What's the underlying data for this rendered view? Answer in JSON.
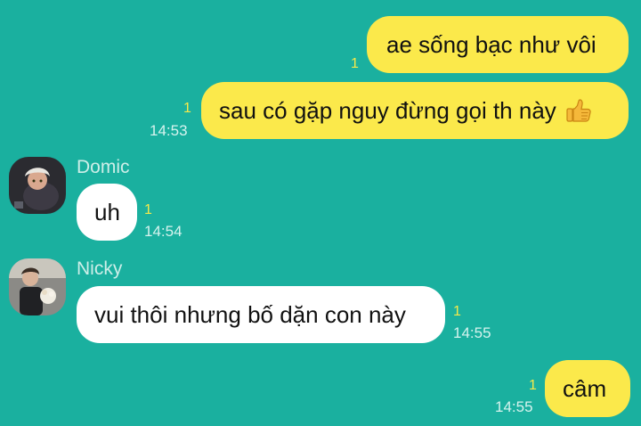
{
  "colors": {
    "background": "#1ab09f",
    "outgoing_bubble": "#fbe94b",
    "incoming_bubble": "#ffffff",
    "unread_count": "#f6e94a",
    "timestamp": "#d6f3ee"
  },
  "messages": [
    {
      "direction": "outgoing",
      "text": "ae sống bạc như vôi",
      "unread": "1",
      "time": ""
    },
    {
      "direction": "outgoing",
      "text": "sau có gặp nguy đừng gọi th này",
      "emoji": "thumbs-up-icon",
      "unread": "1",
      "time": "14:53"
    },
    {
      "direction": "incoming",
      "sender": "Domic",
      "text": "uh",
      "unread": "1",
      "time": "14:54"
    },
    {
      "direction": "incoming",
      "sender": "Nicky",
      "text": "vui thôi nhưng bố dặn con này",
      "unread": "1",
      "time": "14:55"
    },
    {
      "direction": "outgoing",
      "text": "câm",
      "unread": "1",
      "time": "14:55"
    }
  ]
}
